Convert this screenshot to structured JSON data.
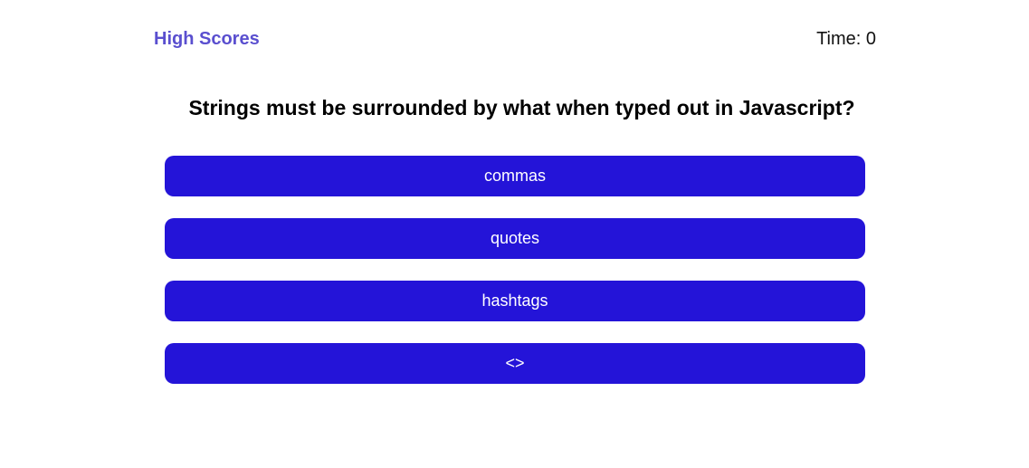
{
  "header": {
    "high_scores_label": "High Scores",
    "timer_label": "Time: 0"
  },
  "quiz": {
    "question": "Strings must be surrounded by what when typed out in Javascript?",
    "answers": [
      "commas",
      "quotes",
      "hashtags",
      "<>"
    ]
  },
  "colors": {
    "accent": "#2414d8",
    "link": "#5a4fcf"
  }
}
